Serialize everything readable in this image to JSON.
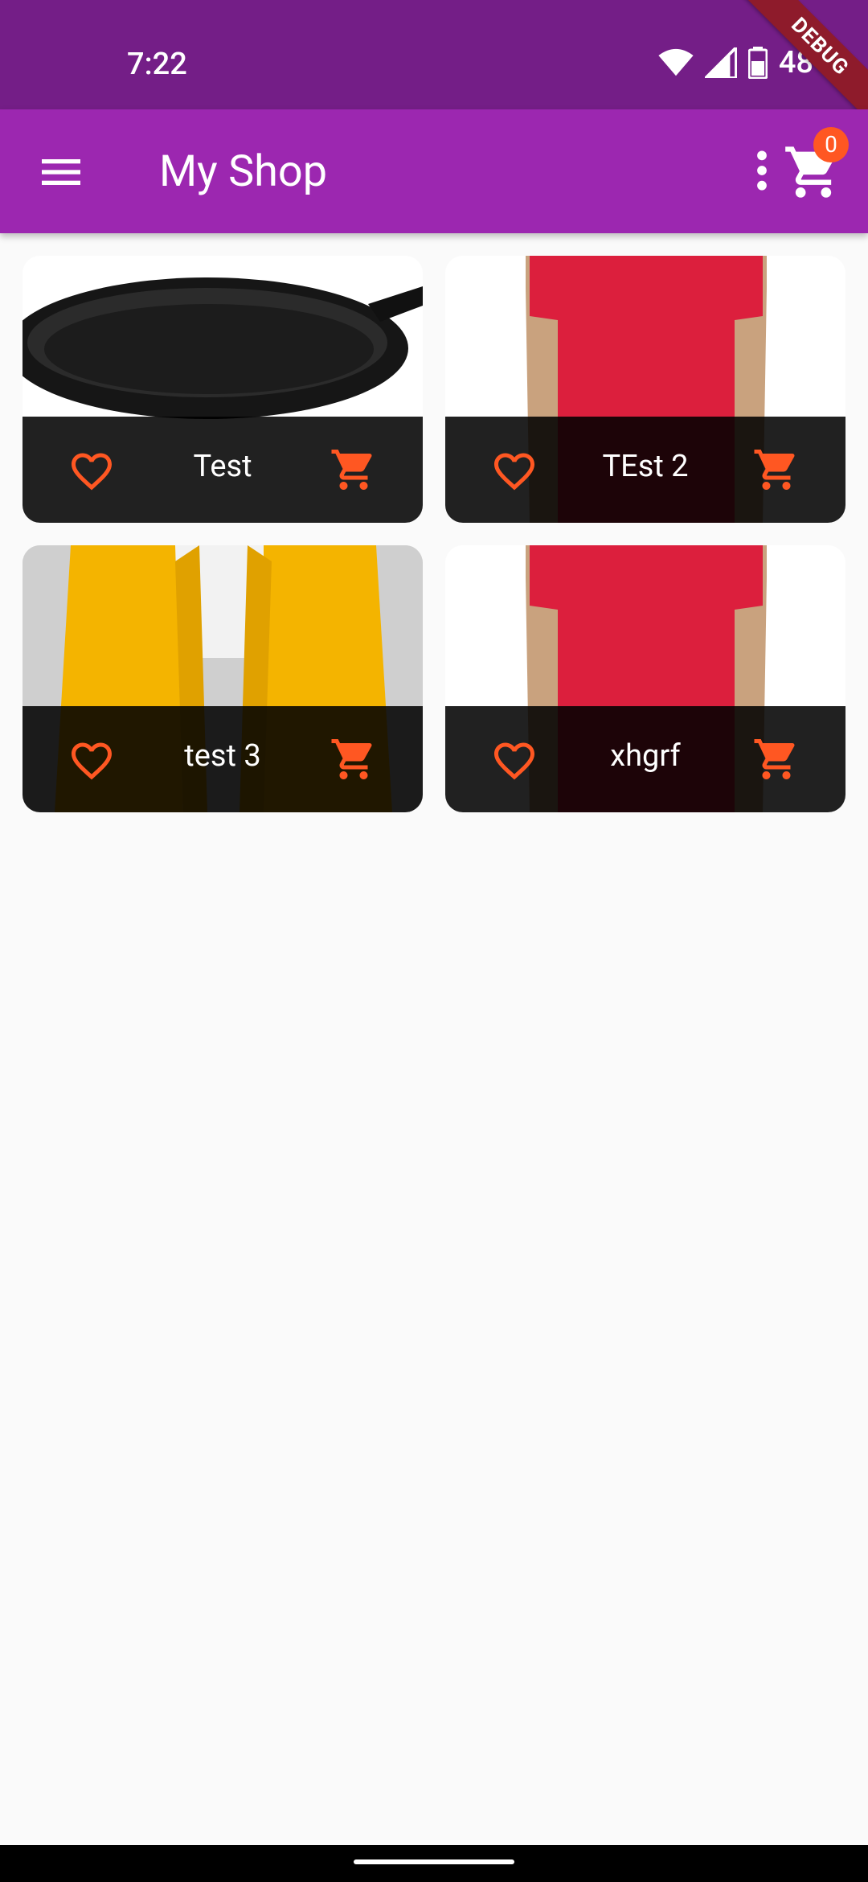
{
  "status": {
    "time": "7:22",
    "battery": "48%",
    "icons": [
      "wifi-icon",
      "cellular-signal-icon",
      "battery-icon"
    ]
  },
  "debug_banner": "DEBUG",
  "app_bar": {
    "title": "My Shop",
    "cart_count": "0",
    "icons": [
      "menu-icon",
      "more-vert-icon",
      "shopping-cart-icon"
    ]
  },
  "products": [
    {
      "title": "Test",
      "image": "cast-iron-skillet"
    },
    {
      "title": "TEst 2",
      "image": "red-t-shirt"
    },
    {
      "title": "test 3",
      "image": "yellow-knit-scarf"
    },
    {
      "title": "xhgrf",
      "image": "red-t-shirt"
    }
  ],
  "colors": {
    "status_bar": "#741e87",
    "app_bar": "#9c27b0",
    "accent": "#ff5722",
    "tile_footer": "#1f1f1f",
    "background": "#fafafa"
  }
}
